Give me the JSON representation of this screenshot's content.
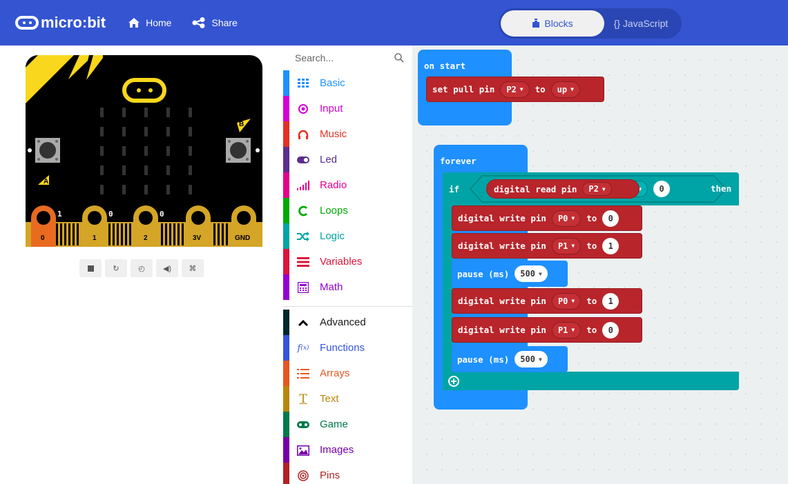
{
  "header": {
    "brand": "micro:bit",
    "home_label": "Home",
    "share_label": "Share",
    "blocks_label": "Blocks",
    "javascript_label": "{} JavaScript"
  },
  "simulator": {
    "pins": [
      {
        "label": "0",
        "num": "1"
      },
      {
        "label": "1",
        "num": "0"
      },
      {
        "label": "2",
        "num": "0"
      },
      {
        "label": "3V"
      },
      {
        "label": "GND"
      }
    ],
    "button_a": "A",
    "button_b": "B"
  },
  "toolbox": {
    "search_placeholder": "Search...",
    "categories": [
      {
        "label": "Basic",
        "color": "#1e90ff",
        "icon": "grid-icon"
      },
      {
        "label": "Input",
        "color": "#d400d4",
        "icon": "radio-button-icon"
      },
      {
        "label": "Music",
        "color": "#e63022",
        "icon": "headphones-icon"
      },
      {
        "label": "Led",
        "color": "#5c2d91",
        "icon": "toggle-icon"
      },
      {
        "label": "Radio",
        "color": "#e3008c",
        "icon": "signal-bars-icon"
      },
      {
        "label": "Loops",
        "color": "#00aa00",
        "icon": "loop-arrow-icon"
      },
      {
        "label": "Logic",
        "color": "#00a4a6",
        "icon": "shuffle-icon"
      },
      {
        "label": "Variables",
        "color": "#dc143c",
        "icon": "list-lines-icon"
      },
      {
        "label": "Math",
        "color": "#9400d3",
        "icon": "calculator-icon"
      },
      {
        "label": "Advanced",
        "color": "#00272b",
        "icon": "chevron-up-icon"
      },
      {
        "label": "Functions",
        "color": "#3455db",
        "icon": "function-icon"
      },
      {
        "label": "Arrays",
        "color": "#e65722",
        "icon": "numbered-list-icon"
      },
      {
        "label": "Text",
        "color": "#b8860b",
        "icon": "text-icon"
      },
      {
        "label": "Game",
        "color": "#007a4b",
        "icon": "gamepad-icon"
      },
      {
        "label": "Images",
        "color": "#7600a8",
        "icon": "image-icon"
      },
      {
        "label": "Pins",
        "color": "#b22222",
        "icon": "target-icon"
      }
    ]
  },
  "workspace": {
    "on_start": "on start",
    "set_pull": {
      "text": "set pull pin",
      "pin": "P2",
      "to": "to",
      "mode": "up"
    },
    "forever": "forever",
    "if_block": {
      "if": "if",
      "read": "digital read pin",
      "pin": "P2",
      "op": "=",
      "value": "0",
      "then": "then"
    },
    "statements": [
      {
        "type": "write",
        "text": "digital write pin",
        "pin": "P0",
        "to": "to",
        "value": "0"
      },
      {
        "type": "write",
        "text": "digital write pin",
        "pin": "P1",
        "to": "to",
        "value": "1"
      },
      {
        "type": "pause",
        "text": "pause (ms)",
        "value": "500"
      },
      {
        "type": "write",
        "text": "digital write pin",
        "pin": "P0",
        "to": "to",
        "value": "1"
      },
      {
        "type": "write",
        "text": "digital write pin",
        "pin": "P1",
        "to": "to",
        "value": "0"
      },
      {
        "type": "pause",
        "text": "pause (ms)",
        "value": "500"
      }
    ]
  }
}
